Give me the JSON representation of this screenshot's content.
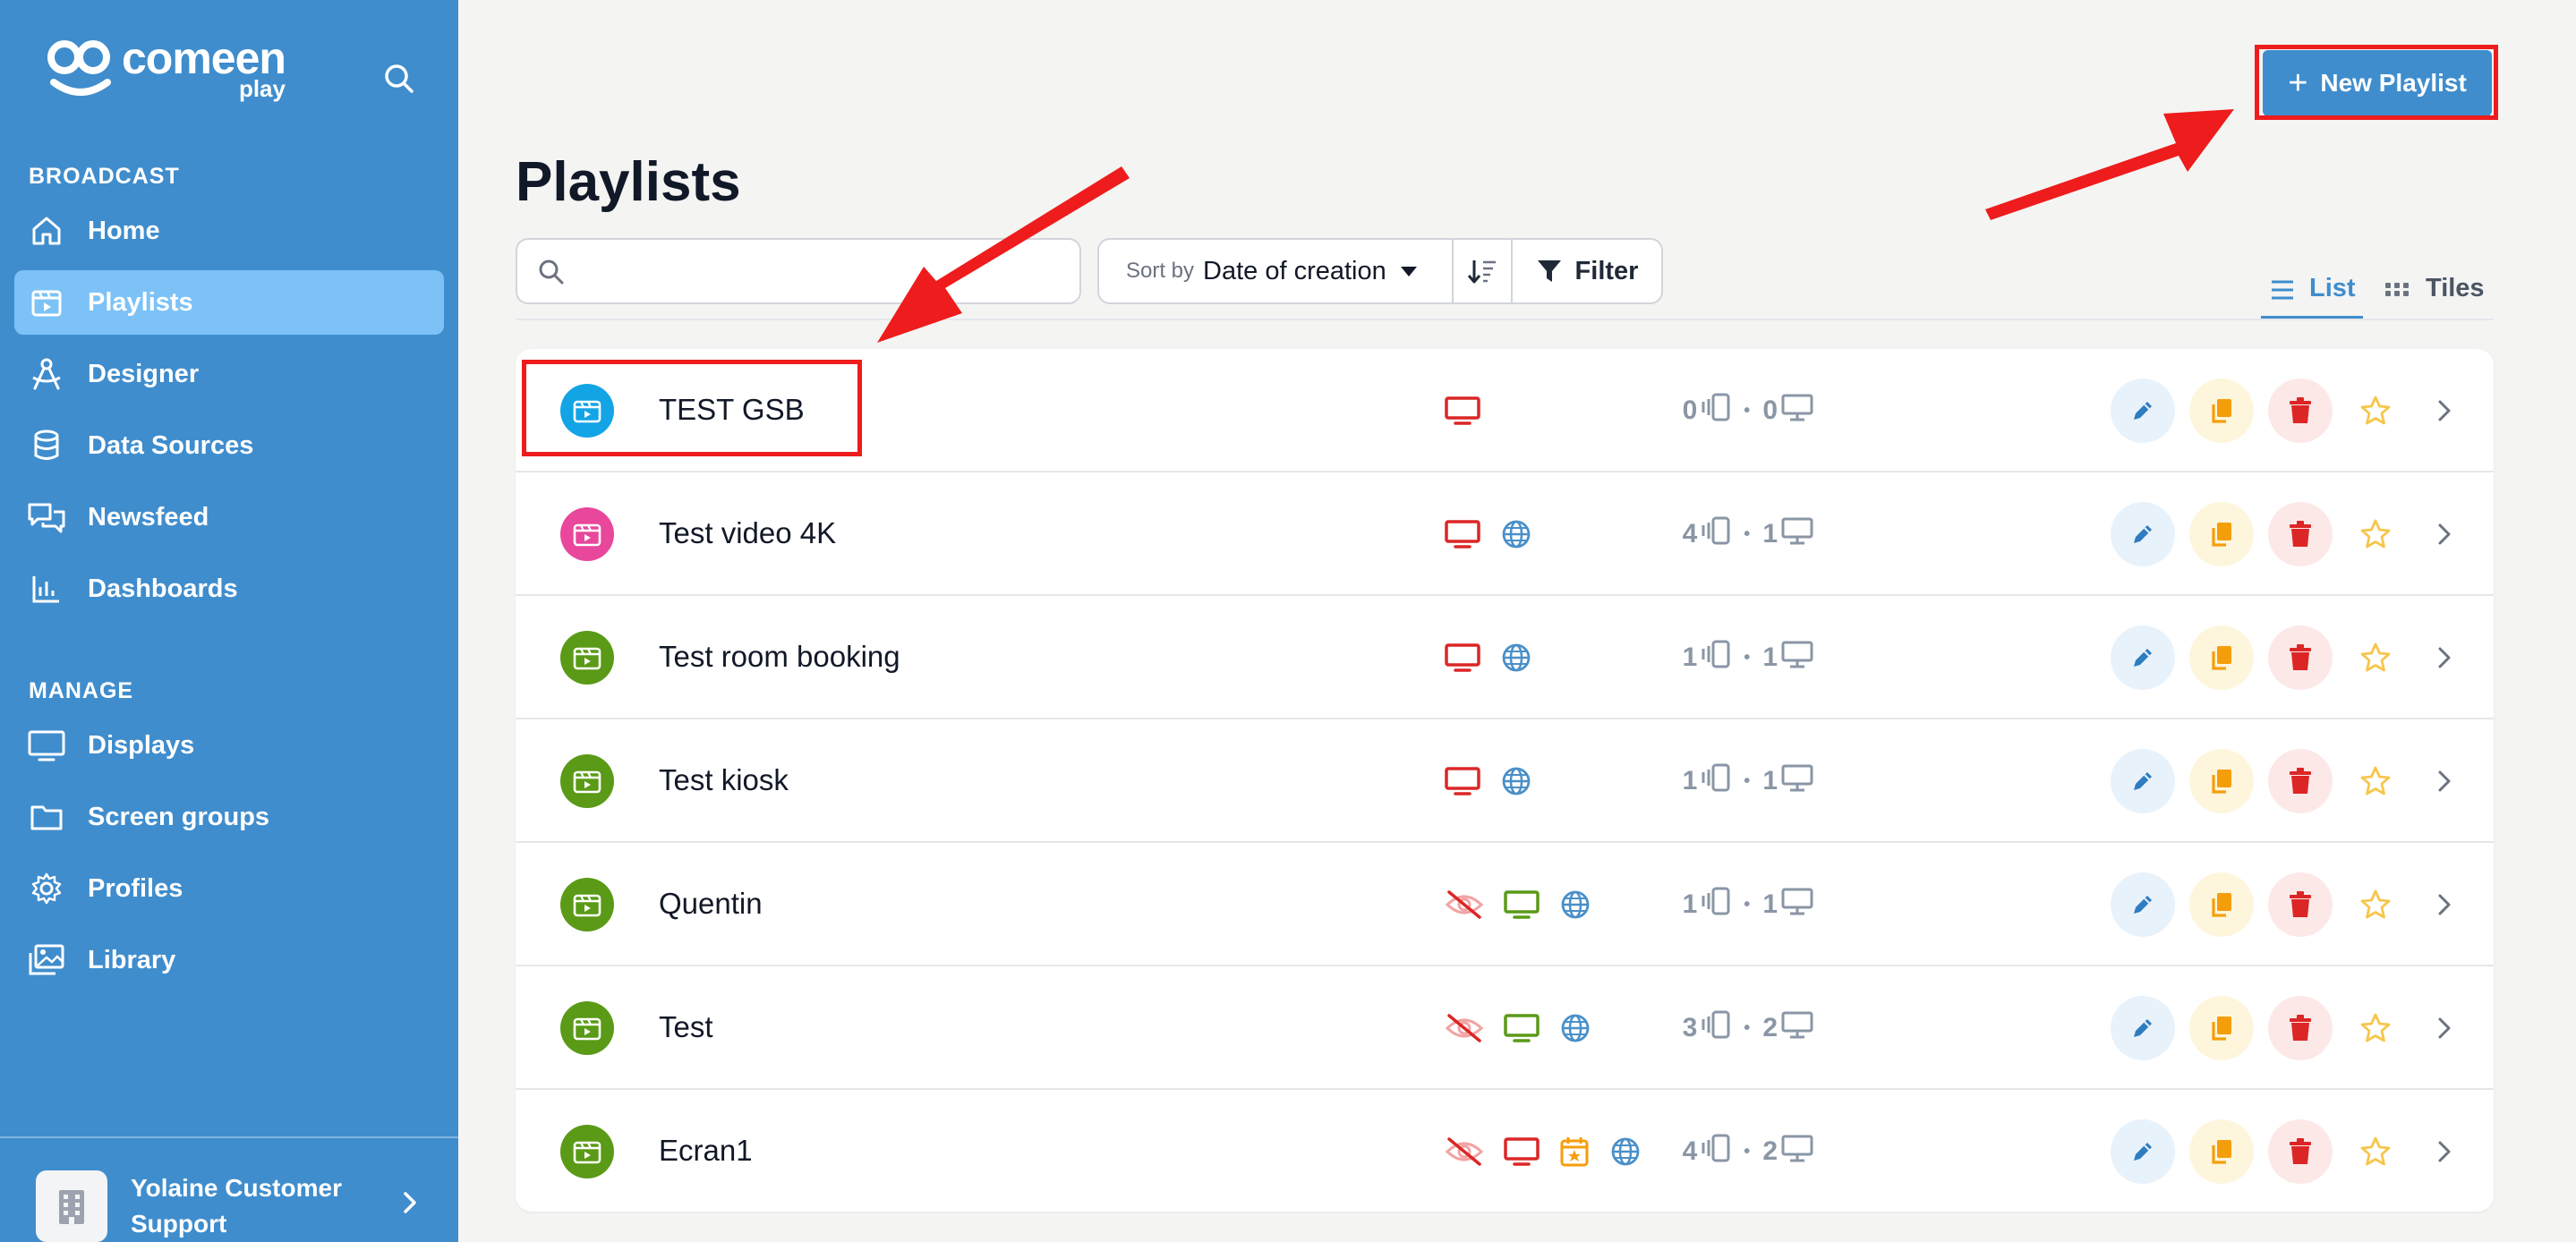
{
  "sidebar": {
    "logo_name": "comeen",
    "logo_sub": "play",
    "sections": [
      {
        "title": "BROADCAST"
      },
      {
        "title": "MANAGE"
      }
    ],
    "items": [
      {
        "label": "Home",
        "icon": "home-icon"
      },
      {
        "label": "Playlists",
        "icon": "playlist-icon",
        "active": true
      },
      {
        "label": "Designer",
        "icon": "designer-icon"
      },
      {
        "label": "Data Sources",
        "icon": "database-icon"
      },
      {
        "label": "Newsfeed",
        "icon": "newsfeed-icon"
      },
      {
        "label": "Dashboards",
        "icon": "dashboard-icon"
      },
      {
        "label": "Displays",
        "icon": "display-icon"
      },
      {
        "label": "Screen groups",
        "icon": "folder-icon"
      },
      {
        "label": "Profiles",
        "icon": "gear-icon"
      },
      {
        "label": "Library",
        "icon": "library-icon"
      }
    ],
    "org_name": "Yolaine Customer Support"
  },
  "header": {
    "new_playlist_label": "New Playlist",
    "title": "Playlists"
  },
  "toolbar": {
    "search_value": "",
    "sort_by_label": "Sort by",
    "sort_value": "Date of creation",
    "filter_label": "Filter",
    "view_list_label": "List",
    "view_tiles_label": "Tiles"
  },
  "colors": {
    "sidebar_bg": "#3f8dcd",
    "active_item": "#7cc2f7",
    "annotation_red": "#ee1c1c",
    "icon_blue": "#13a4e6",
    "icon_pink": "#e8479c",
    "icon_green": "#5a9a17"
  },
  "playlists": [
    {
      "name": "TEST GSB",
      "icon_color": "#13a4e6",
      "hidden": false,
      "display_status": "red",
      "scheduled": false,
      "web": false,
      "devices": "0",
      "screens": "0"
    },
    {
      "name": "Test video 4K",
      "icon_color": "#e8479c",
      "hidden": false,
      "display_status": "red",
      "scheduled": false,
      "web": true,
      "devices": "4",
      "screens": "1"
    },
    {
      "name": "Test room booking",
      "icon_color": "#5a9a17",
      "hidden": false,
      "display_status": "red",
      "scheduled": false,
      "web": true,
      "devices": "1",
      "screens": "1"
    },
    {
      "name": "Test kiosk",
      "icon_color": "#5a9a17",
      "hidden": false,
      "display_status": "red",
      "scheduled": false,
      "web": true,
      "devices": "1",
      "screens": "1"
    },
    {
      "name": "Quentin",
      "icon_color": "#5a9a17",
      "hidden": true,
      "display_status": "green",
      "scheduled": false,
      "web": true,
      "devices": "1",
      "screens": "1"
    },
    {
      "name": "Test",
      "icon_color": "#5a9a17",
      "hidden": true,
      "display_status": "green",
      "scheduled": false,
      "web": true,
      "devices": "3",
      "screens": "2"
    },
    {
      "name": "Ecran1",
      "icon_color": "#5a9a17",
      "hidden": true,
      "display_status": "red",
      "scheduled": true,
      "web": true,
      "devices": "4",
      "screens": "2"
    }
  ],
  "count_separator": "•"
}
